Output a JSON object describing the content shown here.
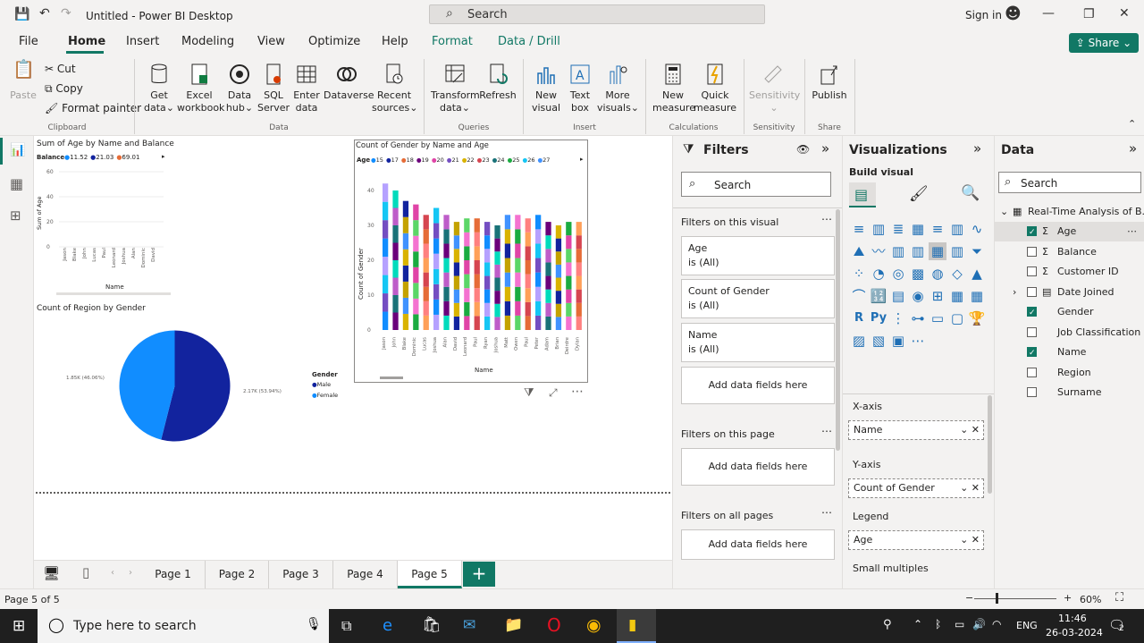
{
  "app": {
    "title": "Untitled - Power BI Desktop",
    "search_placeholder": "Search",
    "signin": "Sign in",
    "share": "Share"
  },
  "tabs": [
    "File",
    "Home",
    "Insert",
    "Modeling",
    "View",
    "Optimize",
    "Help",
    "Format",
    "Data / Drill"
  ],
  "ribbon": {
    "clipboard": {
      "paste": "Paste",
      "cut": "Cut",
      "copy": "Copy",
      "format_painter": "Format painter",
      "group": "Clipboard"
    },
    "data": {
      "get_data": [
        "Get",
        "data"
      ],
      "excel": [
        "Excel",
        "workbook"
      ],
      "data_hub": [
        "Data",
        "hub"
      ],
      "sql": [
        "SQL",
        "Server"
      ],
      "enter": [
        "Enter",
        "data"
      ],
      "dataverse": "Dataverse",
      "recent": [
        "Recent",
        "sources"
      ],
      "group": "Data"
    },
    "queries": {
      "transform": [
        "Transform",
        "data"
      ],
      "refresh": "Refresh",
      "group": "Queries"
    },
    "insert": {
      "new_visual": [
        "New",
        "visual"
      ],
      "text_box": [
        "Text",
        "box"
      ],
      "more": [
        "More",
        "visuals"
      ],
      "group": "Insert"
    },
    "calc": {
      "new_measure": [
        "New",
        "measure"
      ],
      "quick_measure": [
        "Quick",
        "measure"
      ],
      "group": "Calculations"
    },
    "sensitivity": {
      "label": "Sensitivity",
      "group": "Sensitivity"
    },
    "share": {
      "publish": "Publish",
      "group": "Share"
    }
  },
  "visual1": {
    "title": "Sum of Age by Name and Balance",
    "legend_title": "Balance",
    "legend": [
      "11.52",
      "21.03",
      "69.01"
    ],
    "ylabel": "Sum of Age",
    "xlabel": "Name",
    "yticks": [
      "60",
      "40",
      "20",
      "0"
    ],
    "names": [
      "Jason",
      "Blake",
      "John",
      "Lucas",
      "Paul",
      "Leonard",
      "Joshua",
      "Alan",
      "Dominic",
      "David"
    ]
  },
  "visual2": {
    "title": "Count of Region by Gender",
    "legend_title": "Gender",
    "legend": [
      "Male",
      "Female"
    ],
    "label_left": "1.85K (46.06%)",
    "label_right": "2.17K (53.94%)"
  },
  "visual3": {
    "title": "Count of Gender by Name and Age",
    "legend_title": "Age",
    "legend": [
      "15",
      "17",
      "18",
      "19",
      "20",
      "21",
      "22",
      "23",
      "24",
      "25",
      "26",
      "27"
    ],
    "ylabel": "Count of Gender",
    "xlabel": "Name",
    "yticks": [
      "40",
      "30",
      "20",
      "10",
      "0"
    ],
    "names": [
      "Jason",
      "John",
      "Blake",
      "Dominic",
      "Lucas",
      "Joshua",
      "Alan",
      "David",
      "Leonard",
      "Paul",
      "Ryan",
      "Joshua",
      "Matt",
      "Owen",
      "Paul",
      "Peter",
      "Adam",
      "Brian",
      "Deirdre",
      "Dylan"
    ]
  },
  "filters": {
    "title": "Filters",
    "search": "Search",
    "on_visual": "Filters on this visual",
    "cards": [
      {
        "name": "Age",
        "value": "is (All)"
      },
      {
        "name": "Count of Gender",
        "value": "is (All)"
      },
      {
        "name": "Name",
        "value": "is (All)"
      }
    ],
    "add": "Add data fields here",
    "on_page": "Filters on this page",
    "on_all": "Filters on all pages"
  },
  "viz": {
    "title": "Visualizations",
    "build": "Build visual",
    "xaxis": "X-axis",
    "xaxis_val": "Name",
    "yaxis": "Y-axis",
    "yaxis_val": "Count of Gender",
    "legend": "Legend",
    "legend_val": "Age",
    "small_multiples": "Small multiples"
  },
  "data": {
    "title": "Data",
    "search": "Search",
    "table": "Real-Time Analysis of B...",
    "fields": [
      {
        "name": "Age",
        "checked": true,
        "sigma": true
      },
      {
        "name": "Balance",
        "checked": false,
        "sigma": true
      },
      {
        "name": "Customer ID",
        "checked": false,
        "sigma": true
      },
      {
        "name": "Date Joined",
        "checked": false,
        "sigma": false
      },
      {
        "name": "Gender",
        "checked": true,
        "sigma": false
      },
      {
        "name": "Job Classification",
        "checked": false,
        "sigma": false
      },
      {
        "name": "Name",
        "checked": true,
        "sigma": false
      },
      {
        "name": "Region",
        "checked": false,
        "sigma": false
      },
      {
        "name": "Surname",
        "checked": false,
        "sigma": false
      }
    ]
  },
  "pages": [
    "Page 1",
    "Page 2",
    "Page 3",
    "Page 4",
    "Page 5"
  ],
  "status": {
    "page": "Page 5 of 5",
    "zoom": "60%"
  },
  "taskbar": {
    "search": "Type here to search",
    "lang": "ENG",
    "time": "11:46",
    "date": "26-03-2024",
    "notif": "2"
  },
  "colors": {
    "accent": "#117865",
    "male": "#12239e",
    "female": "#118dff"
  }
}
